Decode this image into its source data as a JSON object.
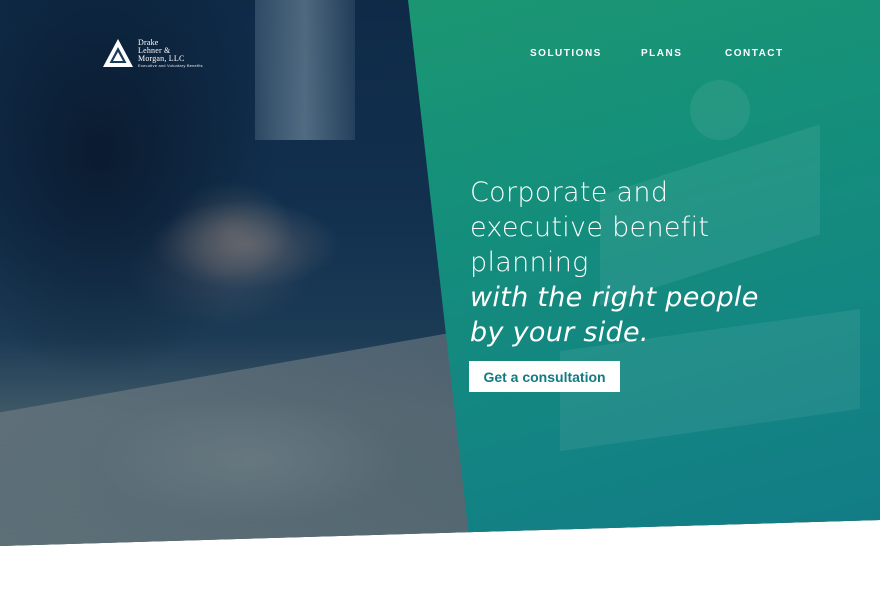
{
  "brand": {
    "name_lines": [
      "Drake",
      "Lehner &",
      "Morgan, LLC"
    ],
    "tagline": "Executive and Voluntary Benefits",
    "colors": {
      "panel_green": "#1f9a6e",
      "panel_teal": "#127b86",
      "cta_text": "#127a82",
      "photo_navy": "#0f2a45"
    }
  },
  "nav": {
    "items": [
      "SOLUTIONS",
      "PLANS",
      "CONTACT"
    ]
  },
  "hero": {
    "headline_lines": [
      "Corporate and",
      "executive benefit",
      "planning"
    ],
    "subhead_lines": [
      "with the right people",
      "by your side."
    ],
    "cta_label": "Get a consultation"
  },
  "icons": {
    "logo": "triangle-logo-icon"
  }
}
